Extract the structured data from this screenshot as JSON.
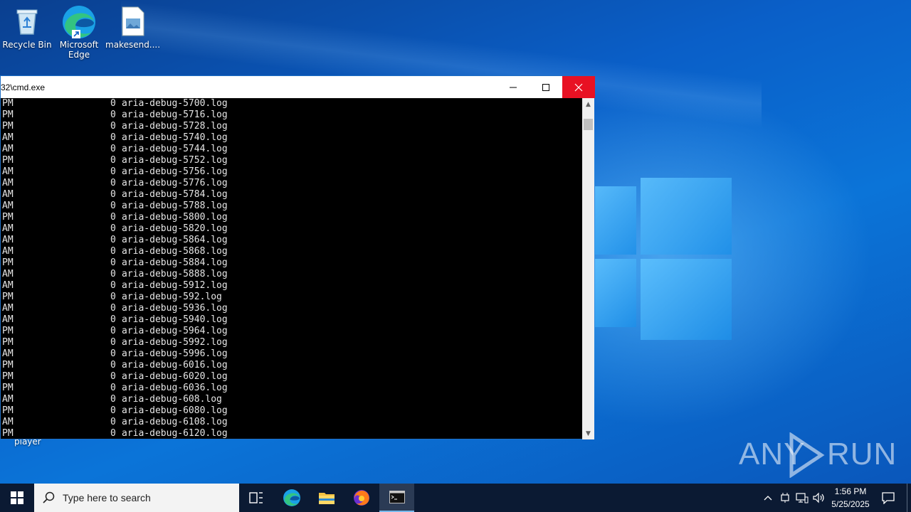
{
  "desktop": {
    "icons": [
      {
        "label": "Recycle Bin"
      },
      {
        "label": "Microsoft\nEdge"
      },
      {
        "label": "makesend...."
      }
    ],
    "stray_label": "player"
  },
  "cmd_window": {
    "title": "32\\cmd.exe",
    "lines": [
      {
        "ampm": "PM",
        "size": "0",
        "name": "aria-debug-5700.log"
      },
      {
        "ampm": "PM",
        "size": "0",
        "name": "aria-debug-5716.log"
      },
      {
        "ampm": "PM",
        "size": "0",
        "name": "aria-debug-5728.log"
      },
      {
        "ampm": "AM",
        "size": "0",
        "name": "aria-debug-5740.log"
      },
      {
        "ampm": "AM",
        "size": "0",
        "name": "aria-debug-5744.log"
      },
      {
        "ampm": "PM",
        "size": "0",
        "name": "aria-debug-5752.log"
      },
      {
        "ampm": "AM",
        "size": "0",
        "name": "aria-debug-5756.log"
      },
      {
        "ampm": "AM",
        "size": "0",
        "name": "aria-debug-5776.log"
      },
      {
        "ampm": "AM",
        "size": "0",
        "name": "aria-debug-5784.log"
      },
      {
        "ampm": "AM",
        "size": "0",
        "name": "aria-debug-5788.log"
      },
      {
        "ampm": "PM",
        "size": "0",
        "name": "aria-debug-5800.log"
      },
      {
        "ampm": "AM",
        "size": "0",
        "name": "aria-debug-5820.log"
      },
      {
        "ampm": "AM",
        "size": "0",
        "name": "aria-debug-5864.log"
      },
      {
        "ampm": "AM",
        "size": "0",
        "name": "aria-debug-5868.log"
      },
      {
        "ampm": "PM",
        "size": "0",
        "name": "aria-debug-5884.log"
      },
      {
        "ampm": "AM",
        "size": "0",
        "name": "aria-debug-5888.log"
      },
      {
        "ampm": "AM",
        "size": "0",
        "name": "aria-debug-5912.log"
      },
      {
        "ampm": "PM",
        "size": "0",
        "name": "aria-debug-592.log"
      },
      {
        "ampm": "AM",
        "size": "0",
        "name": "aria-debug-5936.log"
      },
      {
        "ampm": "AM",
        "size": "0",
        "name": "aria-debug-5940.log"
      },
      {
        "ampm": "PM",
        "size": "0",
        "name": "aria-debug-5964.log"
      },
      {
        "ampm": "PM",
        "size": "0",
        "name": "aria-debug-5992.log"
      },
      {
        "ampm": "AM",
        "size": "0",
        "name": "aria-debug-5996.log"
      },
      {
        "ampm": "PM",
        "size": "0",
        "name": "aria-debug-6016.log"
      },
      {
        "ampm": "PM",
        "size": "0",
        "name": "aria-debug-6020.log"
      },
      {
        "ampm": "PM",
        "size": "0",
        "name": "aria-debug-6036.log"
      },
      {
        "ampm": "AM",
        "size": "0",
        "name": "aria-debug-608.log"
      },
      {
        "ampm": "PM",
        "size": "0",
        "name": "aria-debug-6080.log"
      },
      {
        "ampm": "AM",
        "size": "0",
        "name": "aria-debug-6108.log"
      },
      {
        "ampm": "PM",
        "size": "0",
        "name": "aria-debug-6120.log"
      }
    ]
  },
  "taskbar": {
    "search_placeholder": "Type here to search",
    "clock_time": "1:56 PM",
    "clock_date": "5/25/2025"
  },
  "watermark": {
    "left": "ANY",
    "right": "RUN"
  },
  "colors": {
    "close_button": "#e81123",
    "taskbar": "#0b1a33",
    "desktop_accent": "#0b74d8"
  }
}
